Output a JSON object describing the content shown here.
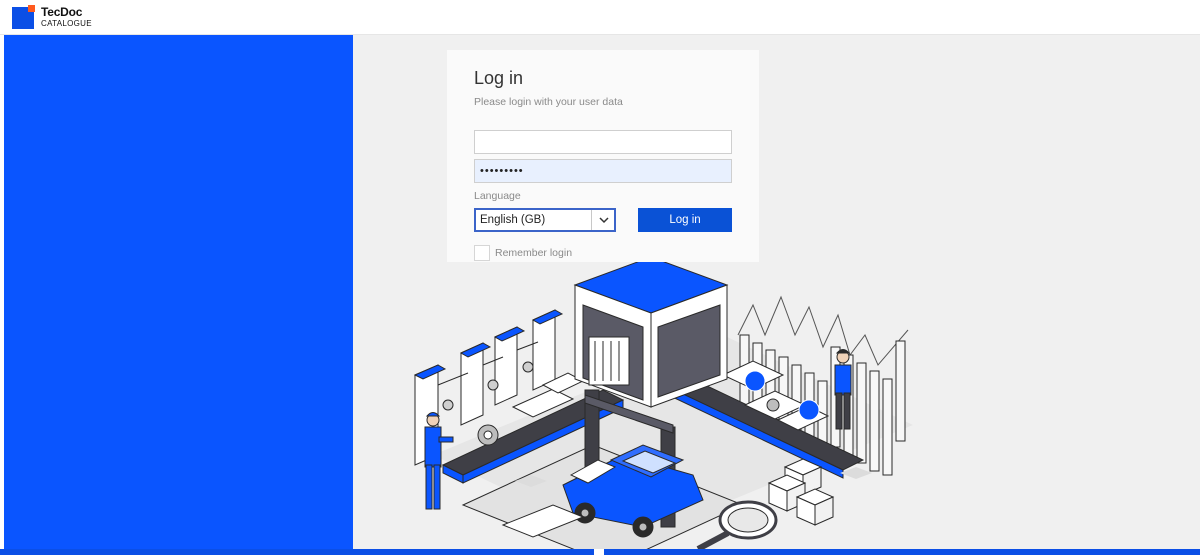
{
  "brand": {
    "name": "TecDoc",
    "subtitle": "CATALOGUE",
    "primary_color": "#0a55ff",
    "accent_color": "#ff5a1f"
  },
  "login": {
    "title": "Log in",
    "subtitle": "Please login with your user data",
    "username_value": "",
    "password_value": "•••••••••",
    "language_label": "Language",
    "language_selected": "English (GB)",
    "submit_label": "Log in",
    "remember_label": "Remember login",
    "remember_checked": false
  },
  "icons": {
    "select_toggle": "chevron-down-icon",
    "logo": "tecdoc-logo-icon"
  },
  "illustration": {
    "subject": "isometric workshop with production line, car on lift, workers, bar chart, magnifier and boxes"
  }
}
